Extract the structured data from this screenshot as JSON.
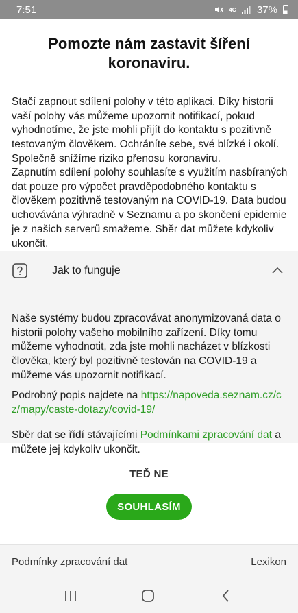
{
  "status_bar": {
    "time": "7:51",
    "network": "4G",
    "battery": "37%",
    "icons": [
      "mute-icon",
      "signal-icon",
      "battery-icon"
    ]
  },
  "dialog": {
    "title": "Pomozte nám zastavit šíření koronaviru.",
    "paragraph1": "Stačí zapnout sdílení polohy v této aplikaci. Díky historii vaší polohy vás můžeme upozornit notifikací, pokud vyhodnotíme, že jste mohli přijít do kontaktu s pozitivně testovaným člověkem. Ochráníte sebe, své blízké i okolí. Společně snížíme riziko přenosu koronaviru.",
    "paragraph2": "Zapnutím sdílení polohy souhlasíte s využitím nasbíraných dat pouze pro výpočet pravděpodobného kontaktu s člověkem pozitivně testovaným na COVID-19. Data budou uchovávána výhradně v Seznamu a po skončení epidemie je z našich serverů smažeme. Sběr dat můžete kdykoliv ukončit."
  },
  "accordion": {
    "title": "Jak to funguje",
    "expanded": true,
    "body1": "Naše systémy budou zpracovávat anonymizovaná data o historii polohy vašeho mobilního zařízení. Díky tomu můžeme vyhodnotit, zda jste mohli nacházet v blízkosti člověka, který byl pozitivně testován na COVID-19 a můžeme vás upozornit notifikací.",
    "body2_prefix": "Podrobný popis najdete na ",
    "body2_link": "https://napoveda.seznam.cz/cz/mapy/caste-dotazy/covid-19/",
    "body3_prefix": "Sběr dat se řídí stávajícími ",
    "body3_link": "Podmínkami zpracování dat",
    "body3_suffix": " a můžete jej kdykoliv ukončit."
  },
  "actions": {
    "later_label": "TEĎ NE",
    "agree_label": "SOUHLASÍM"
  },
  "footer": {
    "left_link": "Podmínky zpracování dat",
    "right_link": "Lexikon"
  },
  "colors": {
    "accent": "#2aa81a",
    "link": "#2f9d27",
    "status_bar": "#8c8c8c",
    "panel_bg": "#f4f4f4"
  }
}
